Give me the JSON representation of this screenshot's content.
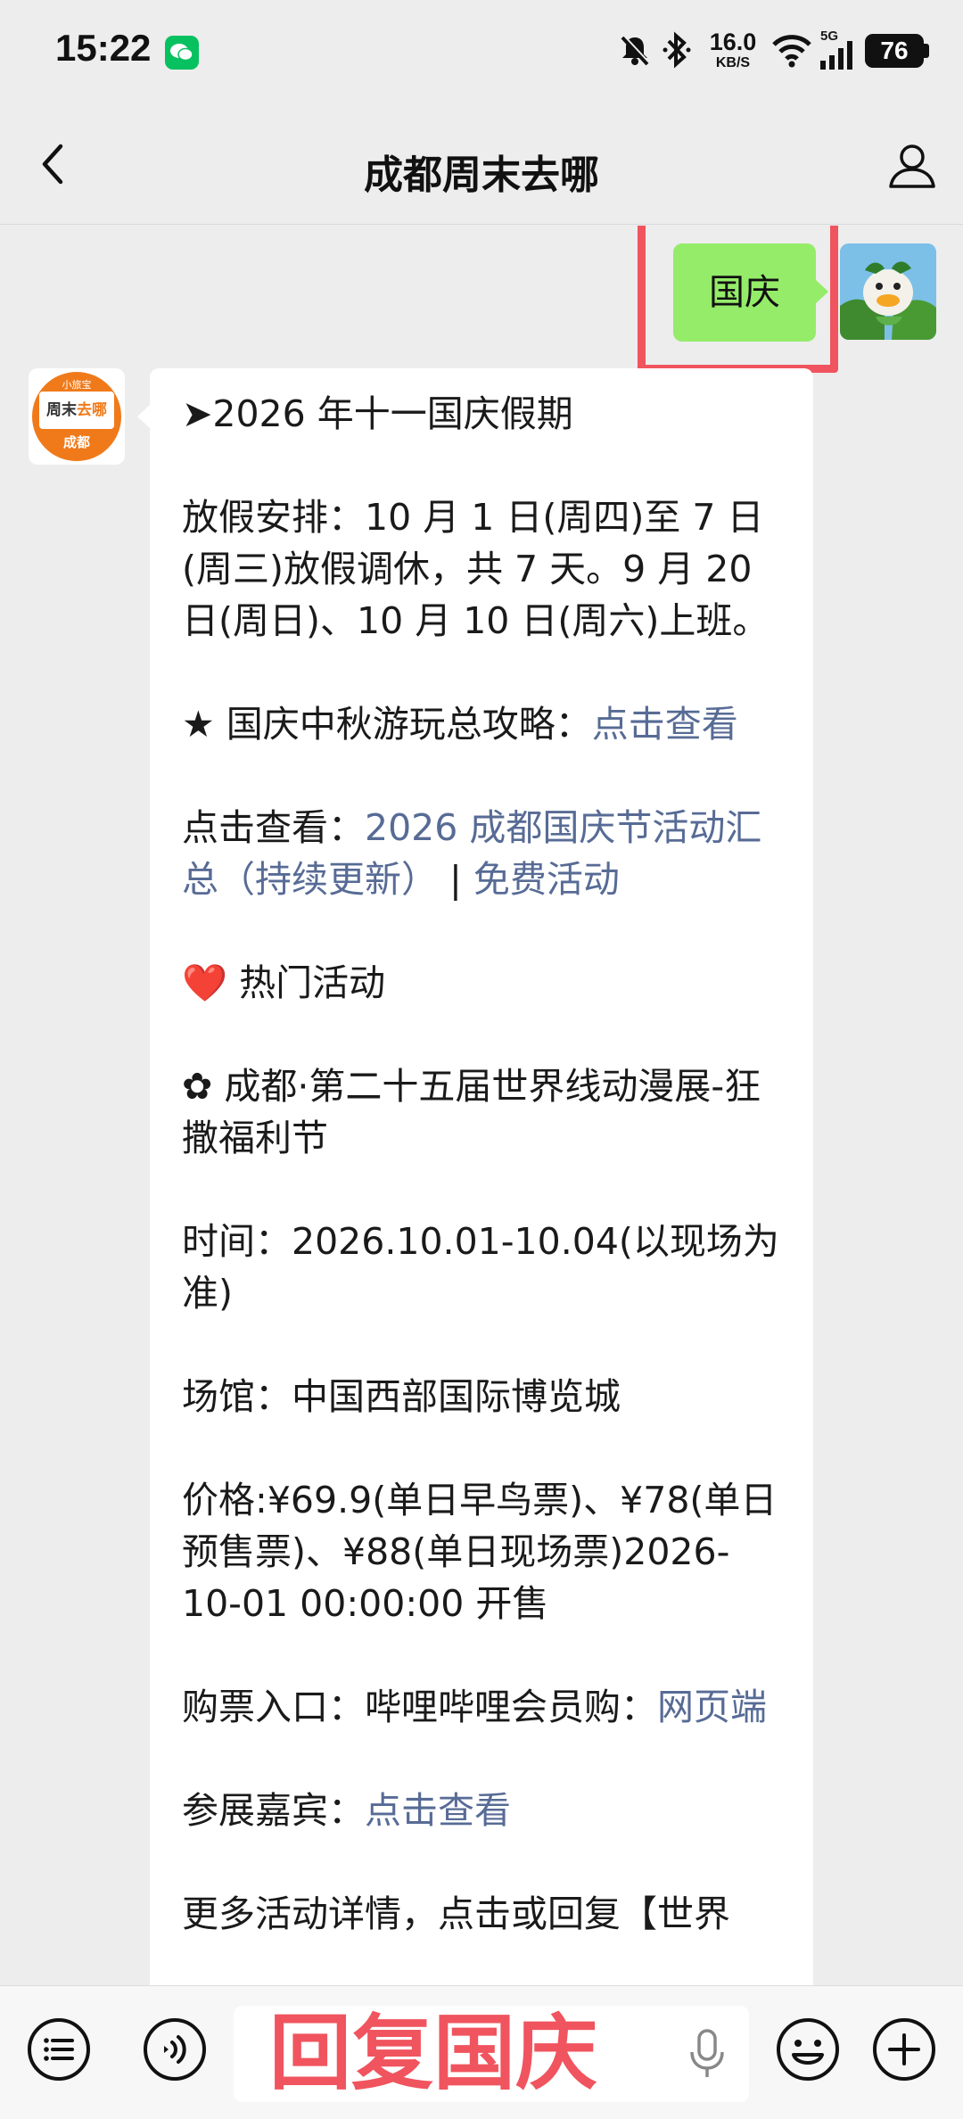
{
  "status_bar": {
    "time": "15:22",
    "net_speed_value": "16.0",
    "net_speed_unit": "KB/S",
    "signal_label": "5G",
    "battery": "76"
  },
  "header": {
    "title": "成都周末去哪",
    "back_icon": "chevron-left-icon",
    "profile_icon": "person-icon"
  },
  "messages": {
    "outgoing": {
      "text": "国庆"
    },
    "incoming": {
      "avatar": {
        "top": "小旅宝",
        "name_a": "周末",
        "name_b": "去哪",
        "city": "成都"
      },
      "title": "➤2026 年十一国庆假期",
      "schedule": "放假安排：10 月 1 日(周四)至 7 日(周三)放假调休，共 7 天。9 月 20 日(周日)、10 月 10 日(周六)上班。",
      "guide_prefix": "★ 国庆中秋游玩总攻略：",
      "guide_link": "点击查看",
      "summary_prefix": "点击查看：",
      "summary_link": "2026 成都国庆节活动汇总（持续更新）",
      "summary_sep": " | ",
      "free_link": "免费活动",
      "hot_heart": "❤️",
      "hot_title": "热门活动",
      "event_title": "✿ 成都·第二十五届世界线动漫展-狂撒福利节",
      "event_time": "时间：2026.10.01-10.04(以现场为准)",
      "event_venue": "场馆：中国西部国际博览城",
      "event_price": "价格:¥69.9(单日早鸟票)、¥78(单日预售票)、¥88(单日现场票)2026-10-01 00:00:00 开售",
      "ticket_prefix": "购票入口：哔哩哔哩会员购：",
      "ticket_link": "网页端",
      "guests_prefix": "参展嘉宾：",
      "guests_link": "点击查看",
      "more_partial": "更多活动详情，点击或回复【世界"
    }
  },
  "toolbar": {
    "input_text": "回复国庆",
    "menu_icon": "menu-list-icon",
    "voice_icon": "voice-icon",
    "mic_icon": "microphone-icon",
    "emoji_icon": "emoji-icon",
    "plus_icon": "plus-icon"
  },
  "colors": {
    "outgoing_bubble": "#95ec69",
    "link": "#576b95",
    "highlight": "#f0545e",
    "background": "#ededed"
  }
}
